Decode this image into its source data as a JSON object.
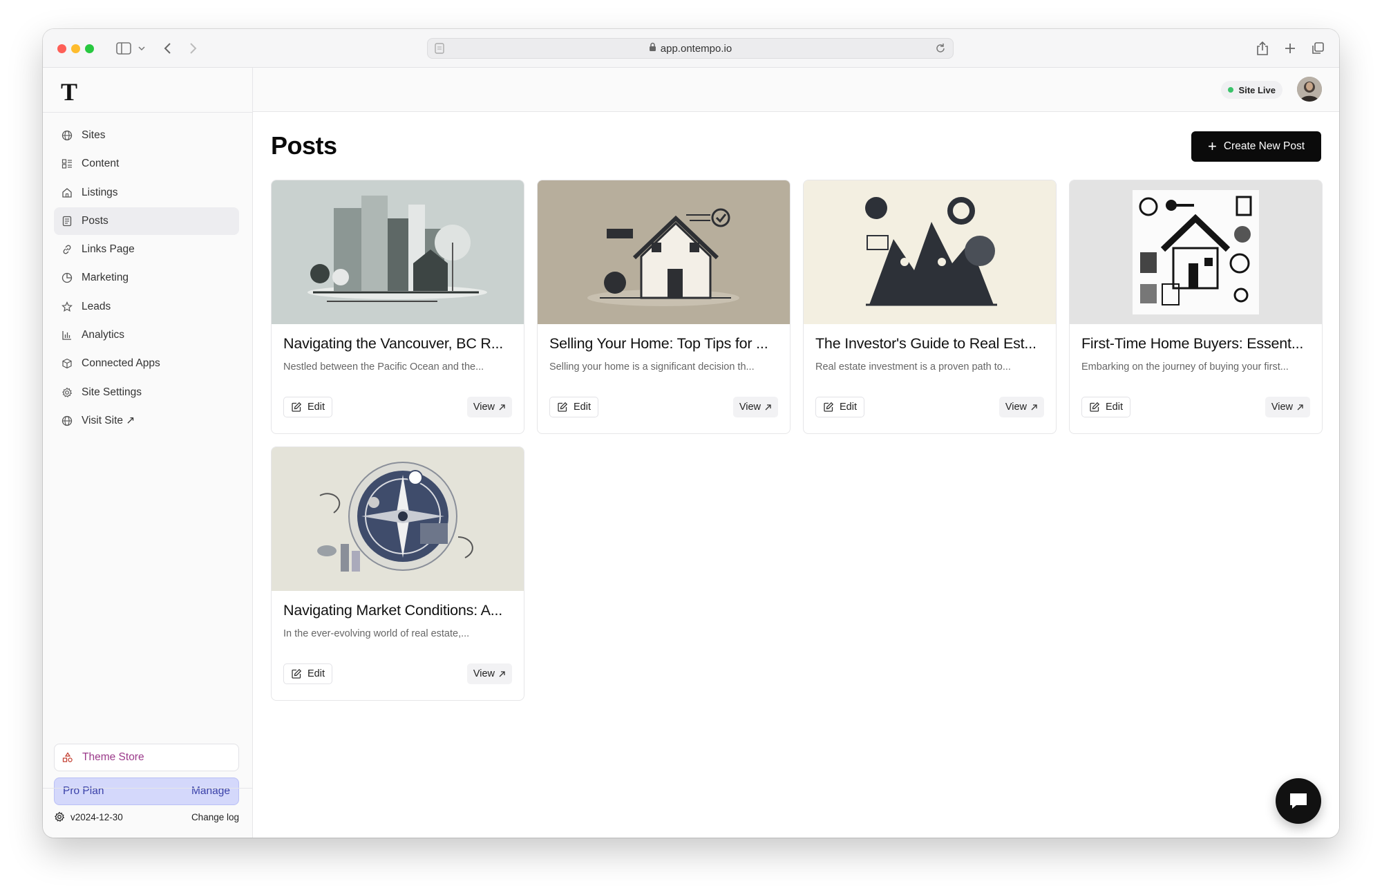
{
  "browser": {
    "url": "app.ontempo.io"
  },
  "sidebar": {
    "logo": "T",
    "items": [
      {
        "label": "Sites",
        "icon": "globe-icon"
      },
      {
        "label": "Content",
        "icon": "content-icon"
      },
      {
        "label": "Listings",
        "icon": "home-icon"
      },
      {
        "label": "Posts",
        "icon": "posts-icon",
        "active": true
      },
      {
        "label": "Links Page",
        "icon": "link-icon"
      },
      {
        "label": "Marketing",
        "icon": "pie-icon"
      },
      {
        "label": "Leads",
        "icon": "star-icon"
      },
      {
        "label": "Analytics",
        "icon": "bar-chart-icon"
      },
      {
        "label": "Connected Apps",
        "icon": "cube-icon"
      },
      {
        "label": "Site Settings",
        "icon": "gear-icon"
      },
      {
        "label": "Visit Site ↗",
        "icon": "globe-icon"
      }
    ],
    "theme_store": "Theme Store",
    "plan": {
      "label": "Pro Plan",
      "action": "Manage"
    },
    "version": "v2024-12-30",
    "changelog": "Change log"
  },
  "header": {
    "status": "Site Live",
    "status_color": "#3ac36a"
  },
  "main": {
    "title": "Posts",
    "create_label": "Create New Post",
    "edit_label": "Edit",
    "view_label": "View",
    "posts": [
      {
        "title": "Navigating the Vancouver, BC R...",
        "desc": "Nestled between the Pacific Ocean and the..."
      },
      {
        "title": "Selling Your Home: Top Tips for ...",
        "desc": "Selling your home is a significant decision th..."
      },
      {
        "title": "The Investor's Guide to Real Est...",
        "desc": "Real estate investment is a proven path to..."
      },
      {
        "title": "First-Time Home Buyers: Essent...",
        "desc": "Embarking on the journey of buying your first..."
      },
      {
        "title": "Navigating Market Conditions: A...",
        "desc": "In the ever-evolving world of real estate,..."
      }
    ]
  }
}
